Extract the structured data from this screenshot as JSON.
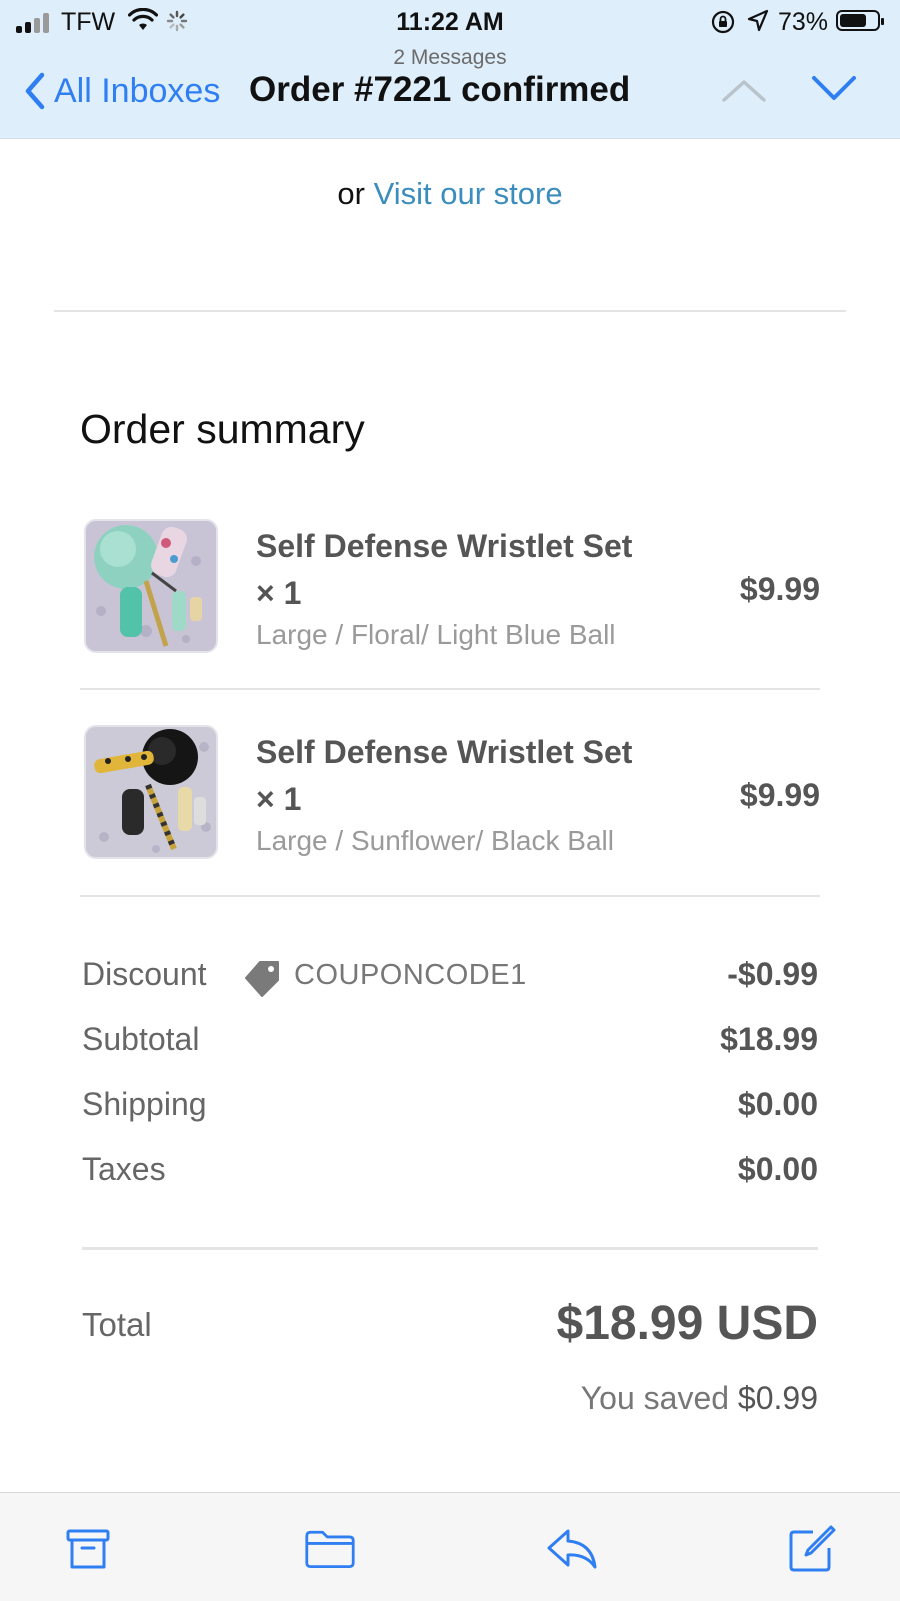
{
  "status_bar": {
    "carrier": "TFW",
    "time": "11:22 AM",
    "battery": "73%",
    "battery_level": 0.73,
    "signal_bars": 2
  },
  "header": {
    "message_count": "2 Messages",
    "back_label": "All Inboxes",
    "subject": "Order #7221 confirmed"
  },
  "email": {
    "store_prefix": "or",
    "store_link": "Visit our store",
    "summary_title": "Order summary",
    "items": [
      {
        "name": "Self Defense Wristlet Set × 1",
        "variant": "Large / Floral/ Light Blue Ball",
        "price": "$9.99"
      },
      {
        "name": "Self Defense Wristlet Set × 1",
        "variant": "Large / Sunflower/ Black Ball",
        "price": "$9.99"
      }
    ],
    "discount": {
      "label": "Discount",
      "code": "COUPONCODE1",
      "value": "-$0.99"
    },
    "subtotal": {
      "label": "Subtotal",
      "value": "$18.99"
    },
    "shipping": {
      "label": "Shipping",
      "value": "$0.00"
    },
    "taxes": {
      "label": "Taxes",
      "value": "$0.00"
    },
    "total": {
      "label": "Total",
      "value": "$18.99 USD"
    },
    "saved": {
      "prefix": "You saved",
      "amount": "$0.99"
    }
  },
  "toolbar": {
    "icons": [
      "archive-icon",
      "folder-icon",
      "reply-icon",
      "compose-icon"
    ]
  },
  "colors": {
    "accent": "#2f7ef2",
    "link": "#3b8dbd",
    "header_bg": "#deeefa",
    "toolbar_bg": "#f6f6f6"
  }
}
